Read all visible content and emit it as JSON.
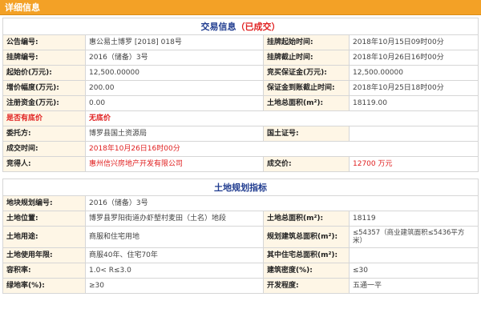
{
  "header": {
    "title": "详细信息"
  },
  "transaction": {
    "title": "交易信息",
    "status": "（已成交）",
    "rows": {
      "announce_no_label": "公告编号:",
      "announce_no": "惠公易土博罗 [2018] 018号",
      "list_start_label": "挂牌起始时间:",
      "list_start": "2018年10月15日09时00分",
      "list_no_label": "挂牌编号:",
      "list_no": "2016（储备）3号",
      "list_end_label": "挂牌截止时间:",
      "list_end": "2018年10月26日16时00分",
      "start_price_label": "起始价(万元):",
      "start_price": "12,500.00000",
      "deposit_label": "竞买保证金(万元):",
      "deposit": "12,500.00000",
      "increment_label": "增价幅度(万元):",
      "increment": "200.00",
      "deposit_deadline_label": "保证金到账截止时间:",
      "deposit_deadline": "2018年10月25日18时00分",
      "reg_capital_label": "注册资金(万元):",
      "reg_capital": "0.00",
      "land_area_label": "土地总面积(m²):",
      "land_area": "18119.00",
      "reserve_label": "是否有底价",
      "reserve": "无底价",
      "delegate_label": "委托方:",
      "delegate": "博罗县国土资源局",
      "land_cert_label": "国土证号:",
      "land_cert": "",
      "deal_time_label": "成交时间:",
      "deal_time": "2018年10月26日16时00分",
      "bidder_label": "竞得人:",
      "bidder": "惠州信兴房地产开发有限公司",
      "deal_price_label": "成交价:",
      "deal_price": "12700 万元"
    }
  },
  "planning": {
    "title": "土地规划指标",
    "rows": {
      "plan_no_label": "地块规划编号:",
      "plan_no": "2016（储备）3号",
      "location_label": "土地位置:",
      "location": "博罗县罗阳街道办虾塱村麦田（土名）地段",
      "total_area_label": "土地总面积(m²):",
      "total_area": "18119",
      "use_label": "土地用途:",
      "use": "商服和住宅用地",
      "build_area_label": "规划建筑总面积(m²):",
      "build_area": "≤54357（商业建筑面积≤5436平方米）",
      "term_label": "土地使用年限:",
      "term": "商服40年、住宅70年",
      "residential_area_label": "其中住宅总面积(m²):",
      "residential_area": "",
      "far_label": "容积率:",
      "far": "1.0< R≤3.0",
      "density_label": "建筑密度(%):",
      "density": "≤30",
      "green_label": "绿地率(%):",
      "green": "≥30",
      "dev_label": "开发程度:",
      "dev": "五通一平"
    }
  }
}
